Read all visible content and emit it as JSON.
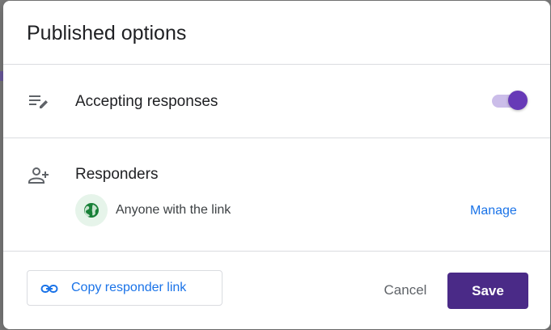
{
  "dialog": {
    "title": "Published options"
  },
  "accepting": {
    "label": "Accepting responses",
    "icon": "edit-list-icon",
    "toggle_on": true
  },
  "responders": {
    "label": "Responders",
    "icon": "person-add-icon",
    "access_text": "Anyone with the link",
    "access_icon": "globe-icon",
    "manage_label": "Manage"
  },
  "footer": {
    "copy_label": "Copy responder link",
    "copy_icon": "link-icon",
    "cancel_label": "Cancel",
    "save_label": "Save"
  },
  "colors": {
    "accent": "#673ab7",
    "save_button": "#4a2a87",
    "link_blue": "#1a73e8",
    "globe_green": "#188038"
  }
}
